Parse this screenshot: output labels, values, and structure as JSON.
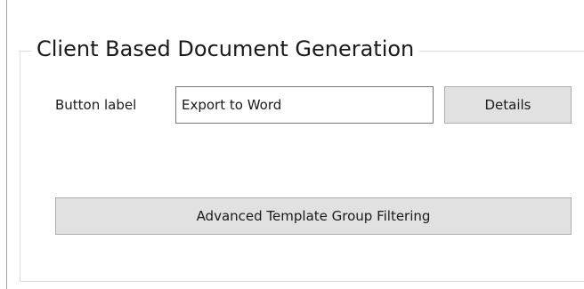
{
  "groupbox": {
    "title": "Client Based Document Generation"
  },
  "button_label_field": {
    "label": "Button label",
    "value": "Export to Word"
  },
  "buttons": {
    "details": "Details",
    "advanced": "Advanced Template Group Filtering"
  },
  "colors": {
    "background": "#ffffff",
    "button_face": "#e1e1e1",
    "button_border": "#adadad",
    "groupbox_border": "#dcdcdc",
    "input_border": "#7a7a7a"
  }
}
